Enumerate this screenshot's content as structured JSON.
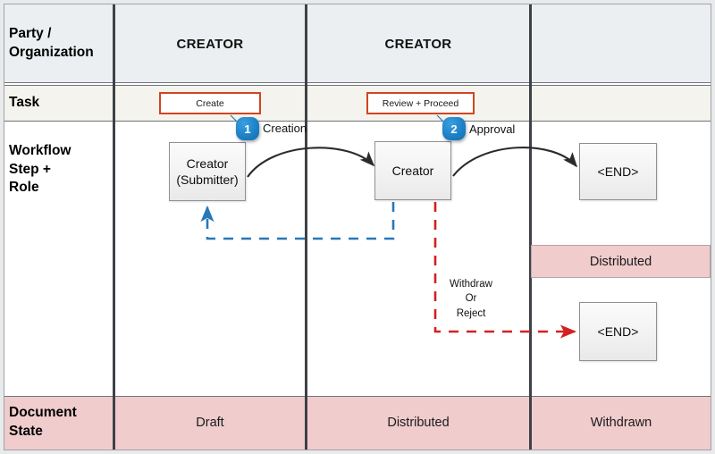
{
  "diagram": {
    "title": "Creator workflow swimlane",
    "colors": {
      "header_bg": "#eceff1",
      "task_bg": "#f4f3ee",
      "state_bg": "#f0cccd",
      "task_border": "#d2451e",
      "badge_blue": "#1b7fc4",
      "return_blue": "#2878b8",
      "reject_red": "#d42020",
      "divider": "#3e4246"
    }
  },
  "row_labels": {
    "party": "Party /\nOrganization",
    "party_line1": "Party /",
    "party_line2": "Organization",
    "task": "Task",
    "workflow_line1": "Workflow",
    "workflow_line2": "Step +",
    "workflow_line3": "Role",
    "state_line1": "Document",
    "state_line2": "State"
  },
  "columns": [
    {
      "header": "CREATOR",
      "document_state": "Draft"
    },
    {
      "header": "CREATOR",
      "document_state": "Distributed"
    },
    {
      "header": "",
      "document_state": "Withdrawn"
    }
  ],
  "tasks": [
    {
      "label": "Create"
    },
    {
      "label": "Review + Proceed"
    }
  ],
  "steps": [
    {
      "number": "1",
      "label": "Creation"
    },
    {
      "number": "2",
      "label": "Approval"
    }
  ],
  "nodes": [
    {
      "line1": "Creator",
      "line2": "(Submitter)"
    },
    {
      "line1": "Creator",
      "line2": ""
    },
    {
      "line1": "<END>",
      "line2": ""
    },
    {
      "line1": "<END>",
      "line2": ""
    }
  ],
  "bands": {
    "distributed": "Distributed"
  },
  "branch": {
    "line1": "Withdraw",
    "line2": "Or",
    "line3": "Reject"
  }
}
